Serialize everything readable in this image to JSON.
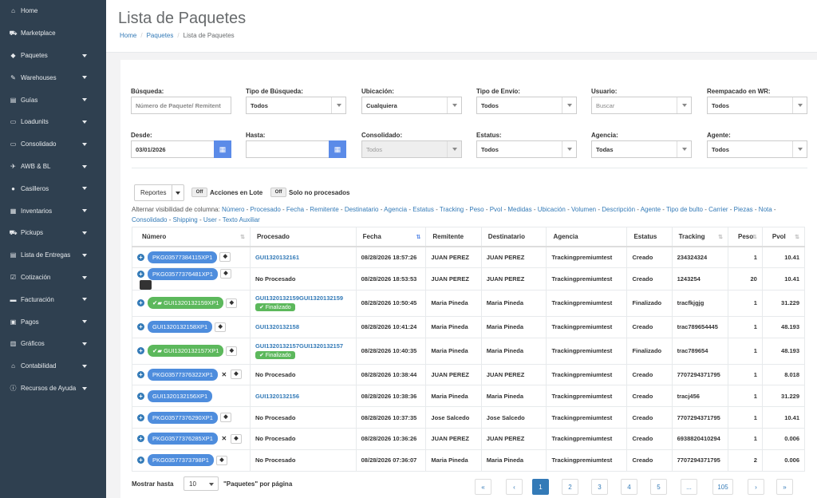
{
  "sidebar": {
    "items": [
      {
        "label": "Home",
        "icon": "home-icon",
        "glyph": "⌂",
        "caret": false
      },
      {
        "label": "Marketplace",
        "icon": "cart-icon",
        "glyph": "⛟",
        "caret": false
      },
      {
        "label": "Paquetes",
        "icon": "tag-icon",
        "glyph": "◆",
        "caret": true
      },
      {
        "label": "Warehouses",
        "icon": "edit-icon",
        "glyph": "✎",
        "caret": true
      },
      {
        "label": "Guías",
        "icon": "list-icon",
        "glyph": "▤",
        "caret": true
      },
      {
        "label": "Loadunits",
        "icon": "folder-icon",
        "glyph": "▭",
        "caret": true
      },
      {
        "label": "Consolidado",
        "icon": "folder-open-icon",
        "glyph": "▭",
        "caret": true
      },
      {
        "label": "AWB & BL",
        "icon": "plane-icon",
        "glyph": "✈",
        "caret": true
      },
      {
        "label": "Casilleros",
        "icon": "map-marker-icon",
        "glyph": "●",
        "caret": true
      },
      {
        "label": "Inventarios",
        "icon": "clipboard-icon",
        "glyph": "▦",
        "caret": true
      },
      {
        "label": "Pickups",
        "icon": "truck-icon",
        "glyph": "⛟",
        "caret": true
      },
      {
        "label": "Lista de Entregas",
        "icon": "list-alt-icon",
        "glyph": "▤",
        "caret": true
      },
      {
        "label": "Cotización",
        "icon": "check-square-icon",
        "glyph": "☑",
        "caret": true
      },
      {
        "label": "Facturación",
        "icon": "credit-card-icon",
        "glyph": "▬",
        "caret": true
      },
      {
        "label": "Pagos",
        "icon": "money-icon",
        "glyph": "▣",
        "caret": true
      },
      {
        "label": "Gráficos",
        "icon": "bar-chart-icon",
        "glyph": "▥",
        "caret": true
      },
      {
        "label": "Contabilidad",
        "icon": "bank-icon",
        "glyph": "⌂",
        "caret": true
      },
      {
        "label": "Recursos de Ayuda",
        "icon": "info-circle-icon",
        "glyph": "ⓘ",
        "caret": true
      }
    ]
  },
  "header": {
    "title": "Lista de Paquetes",
    "breadcrumb": [
      "Home",
      "Paquetes",
      "Lista de Paquetes"
    ]
  },
  "filters": {
    "busqueda": {
      "label": "Búsqueda:",
      "placeholder": "Número de Paquete/ Remitent"
    },
    "tipo_busqueda": {
      "label": "Tipo de Búsqueda:",
      "value": "Todos"
    },
    "ubicacion": {
      "label": "Ubicación:",
      "value": "Cualquiera"
    },
    "tipo_envio": {
      "label": "Tipo de Envío:",
      "value": "Todos"
    },
    "usuario": {
      "label": "Usuario:",
      "value": "Buscar"
    },
    "reempacado": {
      "label": "Reempacado en WR:",
      "value": "Todos"
    },
    "desde": {
      "label": "Desde:",
      "value": "03/01/2026"
    },
    "hasta": {
      "label": "Hasta:",
      "value": ""
    },
    "consolidado": {
      "label": "Consolidado:",
      "value": "Todos"
    },
    "estatus": {
      "label": "Estatus:",
      "value": "Todos"
    },
    "agencia": {
      "label": "Agencia:",
      "value": "Todas"
    },
    "agente": {
      "label": "Agente:",
      "value": "Todos"
    }
  },
  "toolbar": {
    "reportes": "Reportes",
    "toggle_off": "Off",
    "acciones_lote": "Acciones en Lote",
    "solo_no_procesados": "Solo no procesados"
  },
  "column_visibility": {
    "label": "Alternar visibilidad de columna:",
    "columns": [
      "Número",
      "Procesado",
      "Fecha",
      "Remitente",
      "Destinatario",
      "Agencia",
      "Estatus",
      "Tracking",
      "Peso",
      "Pvol",
      "Medidas",
      "Ubicación",
      "Volumen",
      "Descripción",
      "Agente",
      "Tipo de bulto",
      "Carrier",
      "Piezas",
      "Nota",
      "Consolidado",
      "Shipping",
      "User",
      "Texto Auxiliar"
    ]
  },
  "table": {
    "headers": [
      "Número",
      "Procesado",
      "Fecha",
      "Remitente",
      "Destinatario",
      "Agencia",
      "Estatus",
      "Tracking",
      "Peso",
      "Pvol"
    ],
    "rows": [
      {
        "numero": "PKG03577384115XP1",
        "kind": "blue",
        "icon": "tag",
        "procesado": "GUI1320132161",
        "procesado_link": true,
        "finalizado": "",
        "fecha": "08/28/2026 18:57:26",
        "remitente": "JUAN PEREZ",
        "destinatario": "JUAN PEREZ",
        "agencia": "Trackingpremiumtest",
        "estatus": "Creado",
        "tracking": "234324324",
        "peso": "1",
        "pvol": "10.41"
      },
      {
        "numero": "PKG03577376481XP1",
        "kind": "blue",
        "icon": "tag-image",
        "procesado": "No Procesado",
        "procesado_link": false,
        "finalizado": "",
        "fecha": "08/28/2026 18:53:53",
        "remitente": "JUAN PEREZ",
        "destinatario": "JUAN PEREZ",
        "agencia": "Trackingpremiumtest",
        "estatus": "Creado",
        "tracking": "1243254",
        "peso": "20",
        "pvol": "10.41"
      },
      {
        "numero": "GUI1320132159XP1",
        "kind": "green",
        "icon": "tag",
        "procesado": "GUI1320132159GUI1320132159",
        "procesado_link": true,
        "finalizado": "Finalizado",
        "fecha": "08/28/2026 10:50:45",
        "remitente": "Maria Pineda",
        "destinatario": "Maria Pineda",
        "agencia": "Trackingpremiumtest",
        "estatus": "Finalizado",
        "tracking": "tracfkjgjg",
        "peso": "1",
        "pvol": "31.229"
      },
      {
        "numero": "GUI1320132158XP1",
        "kind": "blue",
        "icon": "tag",
        "procesado": "GUI1320132158",
        "procesado_link": true,
        "finalizado": "",
        "fecha": "08/28/2026 10:41:24",
        "remitente": "Maria Pineda",
        "destinatario": "Maria Pineda",
        "agencia": "Trackingpremiumtest",
        "estatus": "Creado",
        "tracking": "trac789654445",
        "peso": "1",
        "pvol": "48.193"
      },
      {
        "numero": "GUI1320132157XP1",
        "kind": "green",
        "icon": "tag",
        "procesado": "GUI1320132157GUI1320132157",
        "procesado_link": true,
        "finalizado": "Finalizado",
        "fecha": "08/28/2026 10:40:35",
        "remitente": "Maria Pineda",
        "destinatario": "Maria Pineda",
        "agencia": "Trackingpremiumtest",
        "estatus": "Finalizado",
        "tracking": "trac789654",
        "peso": "1",
        "pvol": "48.193"
      },
      {
        "numero": "PKG03577376322XP1",
        "kind": "blue",
        "icon": "x-tag",
        "procesado": "No Procesado",
        "procesado_link": false,
        "finalizado": "",
        "fecha": "08/28/2026 10:38:44",
        "remitente": "JUAN PEREZ",
        "destinatario": "JUAN PEREZ",
        "agencia": "Trackingpremiumtest",
        "estatus": "Creado",
        "tracking": "7707294371795",
        "peso": "1",
        "pvol": "8.018"
      },
      {
        "numero": "GUI1320132156XP1",
        "kind": "blue",
        "icon": "none",
        "procesado": "GUI1320132156",
        "procesado_link": true,
        "finalizado": "",
        "fecha": "08/28/2026 10:38:36",
        "remitente": "Maria Pineda",
        "destinatario": "Maria Pineda",
        "agencia": "Trackingpremiumtest",
        "estatus": "Creado",
        "tracking": "tracj456",
        "peso": "1",
        "pvol": "31.229"
      },
      {
        "numero": "PKG03577376290XP1",
        "kind": "blue",
        "icon": "tag",
        "procesado": "No Procesado",
        "procesado_link": false,
        "finalizado": "",
        "fecha": "08/28/2026 10:37:35",
        "remitente": "Jose Salcedo",
        "destinatario": "Jose Salcedo",
        "agencia": "Trackingpremiumtest",
        "estatus": "Creado",
        "tracking": "7707294371795",
        "peso": "1",
        "pvol": "10.41"
      },
      {
        "numero": "PKG03577376285XP1",
        "kind": "blue",
        "icon": "x-tag",
        "procesado": "No Procesado",
        "procesado_link": false,
        "finalizado": "",
        "fecha": "08/28/2026 10:36:26",
        "remitente": "JUAN PEREZ",
        "destinatario": "JUAN PEREZ",
        "agencia": "Trackingpremiumtest",
        "estatus": "Creado",
        "tracking": "6938820410294",
        "peso": "1",
        "pvol": "0.006"
      },
      {
        "numero": "PKG03577373798P1",
        "kind": "blue",
        "icon": "tag",
        "procesado": "No Procesado",
        "procesado_link": false,
        "finalizado": "",
        "fecha": "08/28/2026 07:36:07",
        "remitente": "Maria Pineda",
        "destinatario": "Maria Pineda",
        "agencia": "Trackingpremiumtest",
        "estatus": "Creado",
        "tracking": "7707294371795",
        "peso": "2",
        "pvol": "0.006"
      }
    ]
  },
  "footer": {
    "mostrar": "Mostrar hasta",
    "page_size": "10",
    "per_page": "\"Paquetes\" por página",
    "pages": [
      "«",
      "‹",
      "1",
      "2",
      "3",
      "4",
      "5",
      "...",
      "105",
      "›",
      "»"
    ],
    "active_page": "1"
  },
  "colors": {
    "sidebar": "#2f4050",
    "link": "#337ab7",
    "pill_blue": "#4e8ddd",
    "pill_green": "#5cb85c",
    "calendar": "#5b8be8"
  }
}
